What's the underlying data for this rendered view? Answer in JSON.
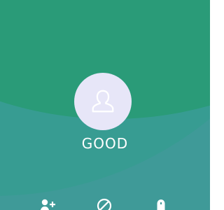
{
  "colors": {
    "background": "#3f9a98",
    "top_shape": "#2a9b78",
    "mid_shape": "#379c92",
    "avatar_bg": "#e7e6f8",
    "avatar_icon": "#ffffff",
    "text": "#ffffff"
  },
  "caller": {
    "name": "GOOD",
    "avatar_icon": "person-icon"
  },
  "actions": [
    {
      "icon": "add-contact-icon"
    },
    {
      "icon": "block-icon"
    },
    {
      "icon": "record-icon"
    }
  ]
}
